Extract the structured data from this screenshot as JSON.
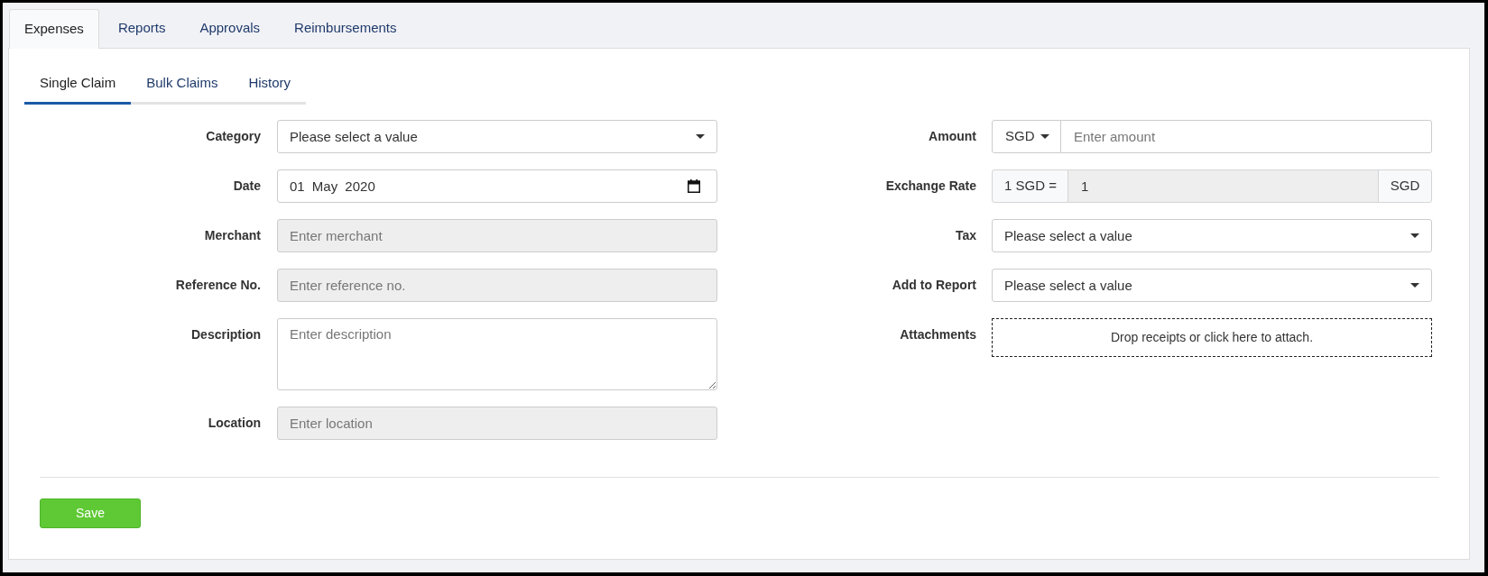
{
  "top_tabs": [
    {
      "label": "Expenses",
      "selected": true
    },
    {
      "label": "Reports",
      "selected": false
    },
    {
      "label": "Approvals",
      "selected": false
    },
    {
      "label": "Reimbursements",
      "selected": false
    }
  ],
  "sub_tabs": [
    {
      "label": "Single Claim",
      "selected": true
    },
    {
      "label": "Bulk Claims",
      "selected": false
    },
    {
      "label": "History",
      "selected": false
    }
  ],
  "form": {
    "left_fields": [
      {
        "label": "Category",
        "kind": "select",
        "placeholder": "Please select a value",
        "disabled": false
      },
      {
        "label": "Date",
        "kind": "date",
        "value": "01 May 2020",
        "disabled": false
      },
      {
        "label": "Merchant",
        "kind": "text",
        "placeholder": "Enter merchant",
        "disabled": true
      },
      {
        "label": "Reference No.",
        "kind": "text",
        "placeholder": "Enter reference no.",
        "disabled": true
      },
      {
        "label": "Description",
        "kind": "textarea",
        "placeholder": "Enter description",
        "disabled": false
      },
      {
        "label": "Location",
        "kind": "text",
        "placeholder": "Enter location",
        "disabled": true
      }
    ],
    "right_fields": [
      {
        "label": "Amount",
        "kind": "amount",
        "currency": "SGD",
        "placeholder": "Enter amount",
        "disabled": false
      },
      {
        "label": "Exchange Rate",
        "kind": "exchange_rate",
        "prefix": "1 SGD =",
        "value": "1",
        "suffix": "SGD",
        "disabled": true
      },
      {
        "label": "Tax",
        "kind": "select",
        "placeholder": "Please select a value",
        "disabled": false
      },
      {
        "label": "Add to Report",
        "kind": "select",
        "placeholder": "Please select a value",
        "disabled": false
      },
      {
        "label": "Attachments",
        "kind": "dropzone",
        "text": "Drop receipts or click here to attach."
      }
    ]
  },
  "buttons": [
    {
      "label": "Save"
    }
  ]
}
